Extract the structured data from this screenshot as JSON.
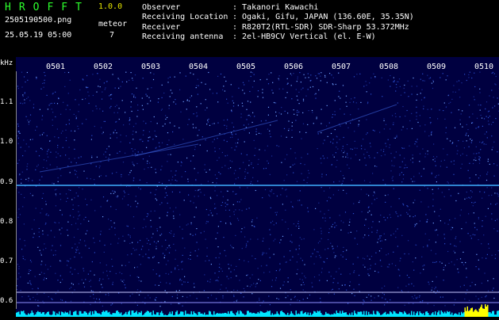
{
  "header": {
    "title": "HROFFT",
    "version": "1.0.0",
    "filename": "2505190500.png",
    "meteor_label": "meteor",
    "datetime": "25.05.19 05:00",
    "meteor_count": "7"
  },
  "info": [
    {
      "key": "Observer",
      "value": ": Takanori Kawachi"
    },
    {
      "key": "Receiving Location",
      "value": ": Ogaki, Gifu, JAPAN (136.60E, 35.35N)"
    },
    {
      "key": "Receiver",
      "value": ": R820T2(RTL-SDR) SDR-Sharp 53.372MHz"
    },
    {
      "key": "Receiving antenna",
      "value": ": 2el-HB9CV Vertical (el. E-W)"
    }
  ],
  "spectrogram": {
    "unit_label": "kHz",
    "time_labels": [
      "0501",
      "0502",
      "0503",
      "0504",
      "0505",
      "0506",
      "0507",
      "0508",
      "0509",
      "0510"
    ],
    "freq_labels": [
      "1.1",
      "1.0",
      "0.9",
      "0.8",
      "0.7",
      "0.6"
    ],
    "colors": {
      "background": "#000040",
      "carrier_line": "#3fb0ff",
      "noise_floor": "#00e5ff",
      "burst": "#ffff00"
    }
  }
}
